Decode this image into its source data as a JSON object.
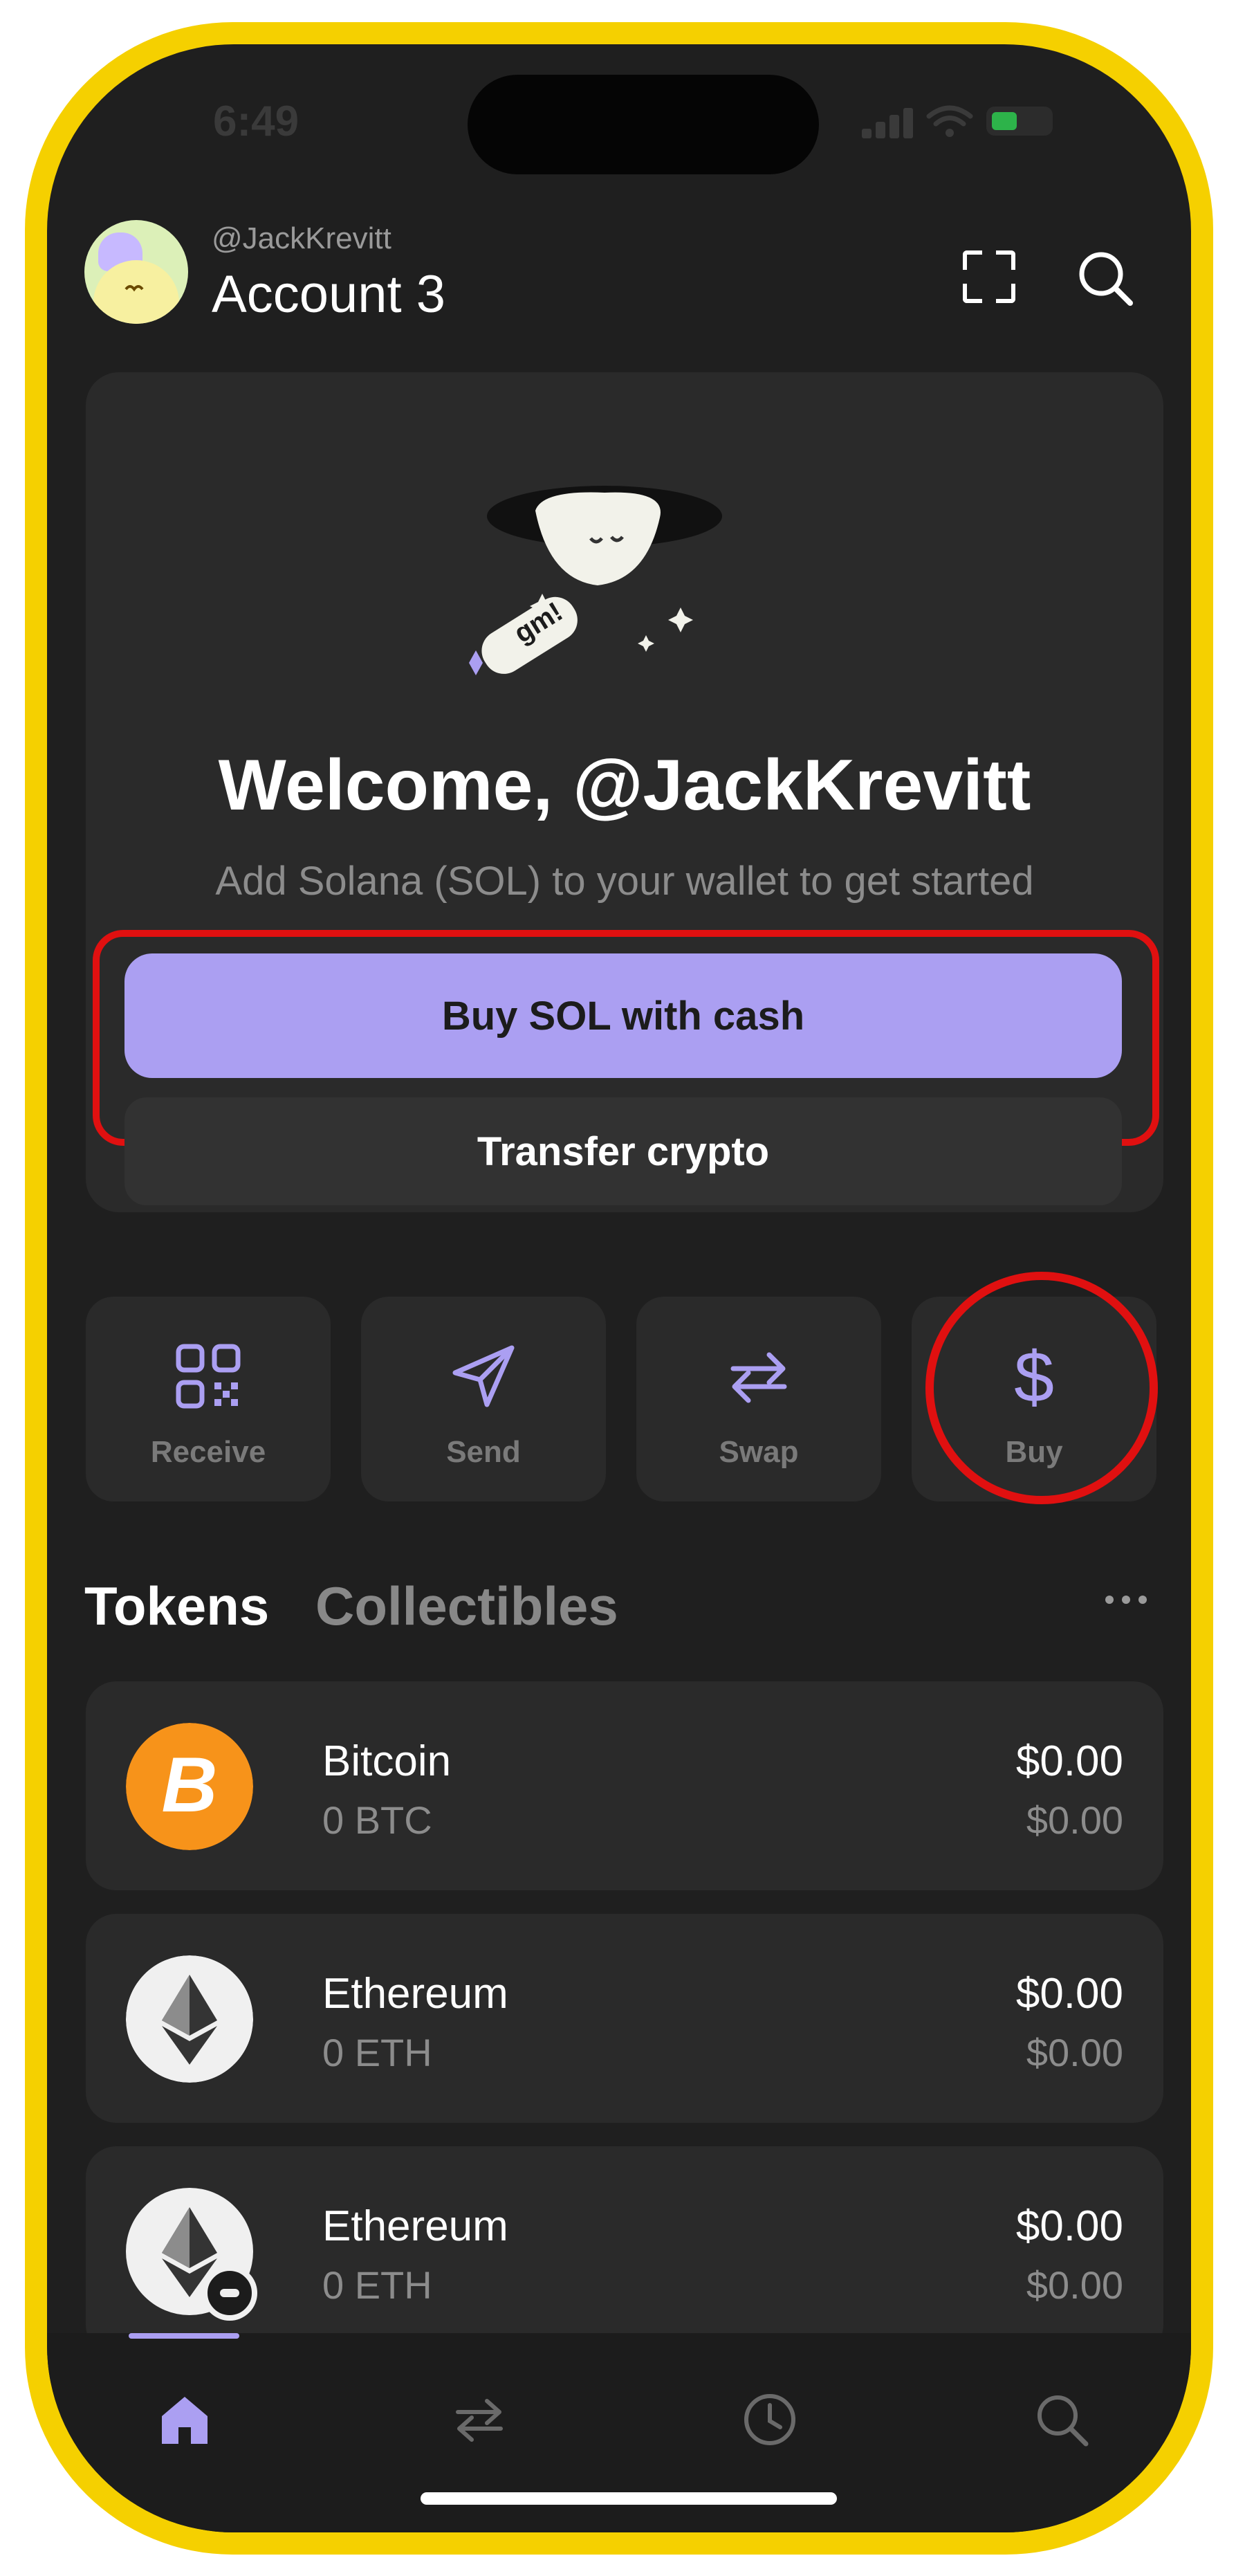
{
  "status_bar": {
    "time": "6:49"
  },
  "header": {
    "handle": "@JackKrevitt",
    "account_name": "Account 3"
  },
  "welcome_card": {
    "illustration_tag": "gm!",
    "title": "Welcome, @JackKrevitt",
    "subtitle": "Add Solana (SOL) to your wallet to get started",
    "primary_button": "Buy SOL with cash",
    "secondary_button": "Transfer crypto"
  },
  "actions": [
    {
      "label": "Receive",
      "icon": "qr-code-icon"
    },
    {
      "label": "Send",
      "icon": "send-icon"
    },
    {
      "label": "Swap",
      "icon": "swap-icon"
    },
    {
      "label": "Buy",
      "icon": "dollar-icon"
    }
  ],
  "tabs": {
    "tokens": "Tokens",
    "collectibles": "Collectibles",
    "active": "Tokens"
  },
  "tokens": [
    {
      "name": "Bitcoin",
      "amount": "0 BTC",
      "value": "$0.00",
      "change": "$0.00",
      "icon": "bitcoin-icon"
    },
    {
      "name": "Ethereum",
      "amount": "0 ETH",
      "value": "$0.00",
      "change": "$0.00",
      "icon": "ethereum-icon"
    },
    {
      "name": "Ethereum",
      "amount": "0 ETH",
      "value": "$0.00",
      "change": "$0.00",
      "icon": "ethereum-base-icon"
    }
  ],
  "bottom_nav": [
    {
      "icon": "home-icon",
      "active": true
    },
    {
      "icon": "swap-icon",
      "active": false
    },
    {
      "icon": "clock-icon",
      "active": false
    },
    {
      "icon": "search-icon",
      "active": false
    }
  ],
  "colors": {
    "accent": "#ab9ff2",
    "highlight": "#e01010",
    "frame": "#f5d000",
    "background": "#1f1f1f",
    "card": "#2a2a2a"
  }
}
